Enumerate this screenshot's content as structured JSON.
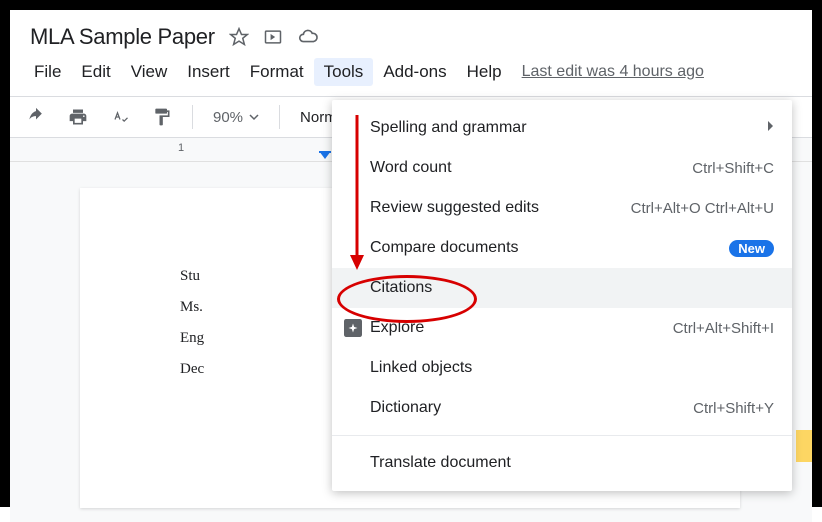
{
  "header": {
    "title": "MLA Sample Paper"
  },
  "menubar": {
    "items": [
      "File",
      "Edit",
      "View",
      "Insert",
      "Format",
      "Tools",
      "Add-ons",
      "Help"
    ],
    "active_index": 5,
    "last_edit": "Last edit was 4 hours ago"
  },
  "toolbar": {
    "zoom": "90%",
    "style": "Normal"
  },
  "ruler": {
    "tick": "1"
  },
  "document": {
    "lines": [
      "Stu",
      "Ms.",
      "Eng",
      "Dec"
    ]
  },
  "tools_menu": {
    "items": [
      {
        "label": "Spelling and grammar",
        "shortcut": "",
        "submenu": true,
        "icon": ""
      },
      {
        "label": "Word count",
        "shortcut": "Ctrl+Shift+C",
        "icon": ""
      },
      {
        "label": "Review suggested edits",
        "shortcut": "Ctrl+Alt+O Ctrl+Alt+U",
        "icon": ""
      },
      {
        "label": "Compare documents",
        "shortcut": "",
        "badge": "New",
        "icon": ""
      },
      {
        "label": "Citations",
        "shortcut": "",
        "highlighted": true,
        "icon": ""
      },
      {
        "label": "Explore",
        "shortcut": "Ctrl+Alt+Shift+I",
        "icon": "explore"
      },
      {
        "label": "Linked objects",
        "shortcut": "",
        "icon": ""
      },
      {
        "label": "Dictionary",
        "shortcut": "Ctrl+Shift+Y",
        "icon": ""
      },
      {
        "label": "Translate document",
        "shortcut": "",
        "icon": ""
      }
    ]
  }
}
